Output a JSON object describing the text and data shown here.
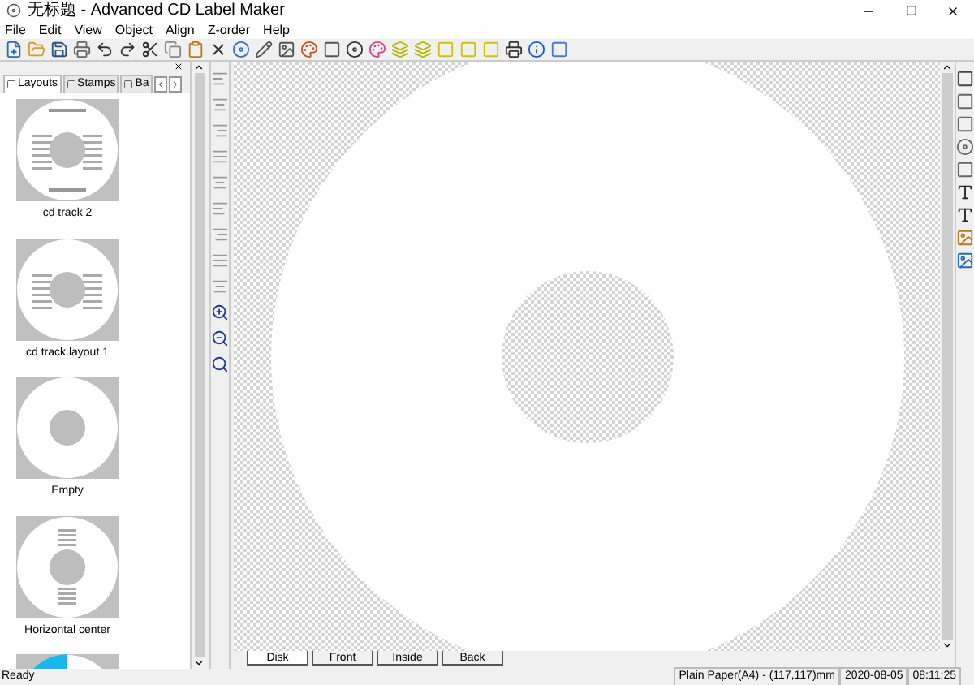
{
  "window": {
    "title": "无标题 - Advanced CD Label Maker"
  },
  "menu": [
    "File",
    "Edit",
    "View",
    "Object",
    "Align",
    "Z-order",
    "Help"
  ],
  "panel_tabs": [
    {
      "label": "Layouts",
      "selected": true
    },
    {
      "label": "Stamps",
      "selected": false
    },
    {
      "label": "Ba",
      "selected": false
    }
  ],
  "layouts": [
    {
      "label": "cd track 2",
      "kind": "track2"
    },
    {
      "label": "cd track layout 1",
      "kind": "track"
    },
    {
      "label": "Empty",
      "kind": "empty"
    },
    {
      "label": "Horizontal center",
      "kind": "horizontal"
    },
    {
      "kind": "blue"
    }
  ],
  "page_tabs": [
    {
      "label": "Disk",
      "selected": true
    },
    {
      "label": "Front",
      "selected": false
    },
    {
      "label": "Inside",
      "selected": false
    },
    {
      "label": "Back",
      "selected": false
    }
  ],
  "status_bar": {
    "message": "Ready",
    "paper": "Plain Paper(A4) - (117,117)mm",
    "date": "2020-08-05",
    "time": "08:11:25"
  }
}
